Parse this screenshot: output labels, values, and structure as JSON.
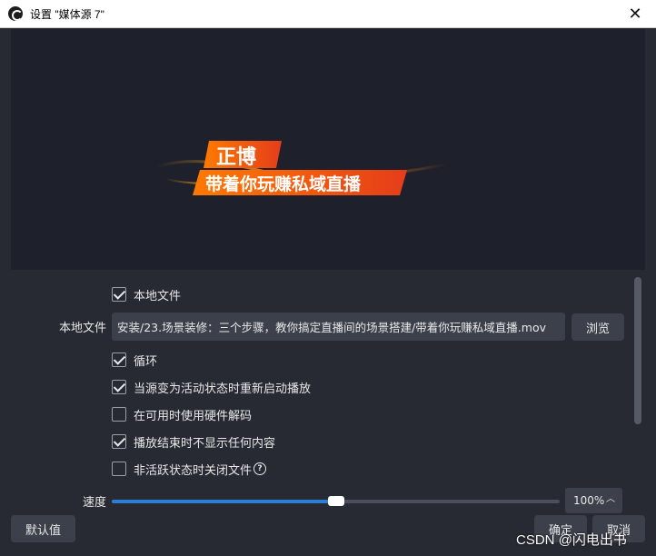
{
  "window": {
    "title": "设置 \"媒体源 7\"",
    "close_glyph": "✕"
  },
  "preview": {
    "banner_line1": "正博",
    "banner_line2": "带着你玩赚私域直播"
  },
  "properties": {
    "local_file_checkbox": {
      "label": "本地文件",
      "checked": true
    },
    "local_file_field": {
      "label": "本地文件",
      "value": "安装/23.场景装修：三个步骤，教你搞定直播间的场景搭建/带着你玩赚私域直播.mov",
      "browse_label": "浏览"
    },
    "loop": {
      "label": "循环",
      "checked": true
    },
    "restart_on_active": {
      "label": "当源变为活动状态时重新启动播放",
      "checked": true
    },
    "hw_decode": {
      "label": "在可用时使用硬件解码",
      "checked": false
    },
    "hide_on_end": {
      "label": "播放结束时不显示任何内容",
      "checked": true
    },
    "close_when_inactive": {
      "label": "非活跃状态时关闭文件",
      "checked": false,
      "help_glyph": "?"
    },
    "speed": {
      "label": "速度",
      "value_text": "100%",
      "fraction": 0.5
    }
  },
  "footer": {
    "defaults_label": "默认值",
    "ok_label": "确定",
    "cancel_label": "取消"
  },
  "watermark": "CSDN @闪电出书",
  "colors": {
    "background": "#272a33",
    "preview_bg": "#1e212b",
    "accent": "#2d7fd6",
    "control_bg": "#3c404b"
  }
}
